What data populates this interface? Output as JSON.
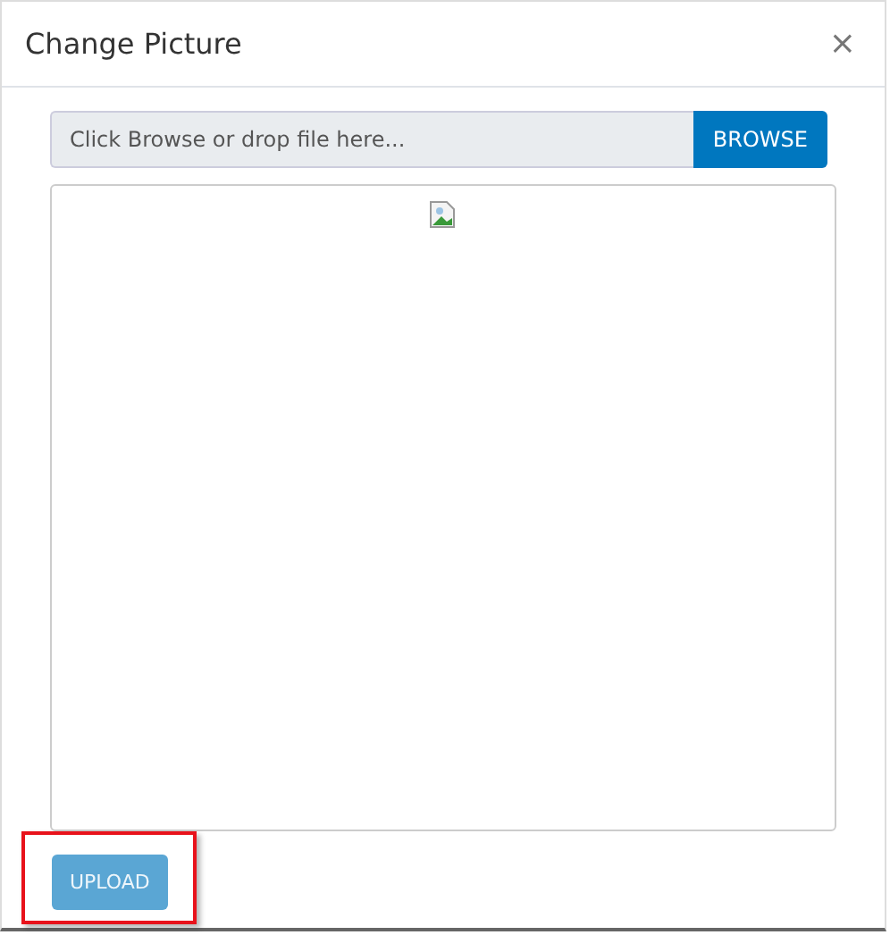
{
  "dialog": {
    "title": "Change Picture",
    "close": "×"
  },
  "file_input": {
    "placeholder": "Click Browse or drop file here...",
    "browse": "BROWSE"
  },
  "preview": {
    "image_broken": true
  },
  "upload": {
    "label": "UPLOAD",
    "disabled": true,
    "highlighted": true
  }
}
